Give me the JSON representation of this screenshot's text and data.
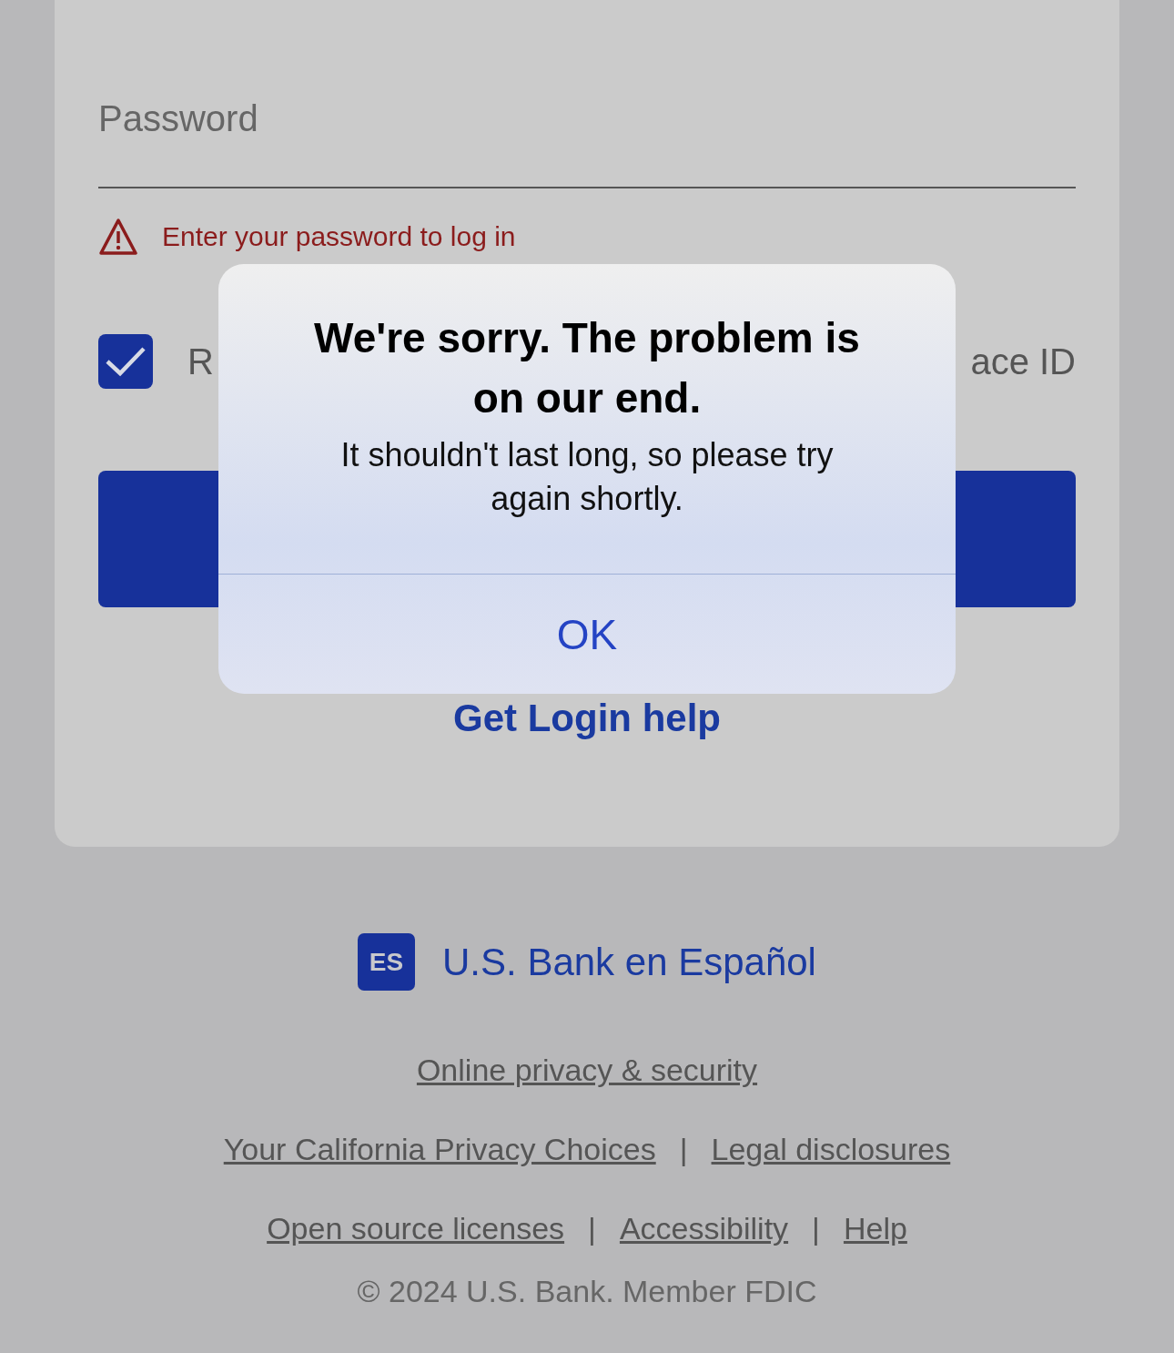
{
  "password_field": {
    "placeholder": "Password"
  },
  "error": {
    "message": "Enter your password to log in"
  },
  "remember": {
    "checked": true,
    "label_start": "R",
    "label_end": "ace ID"
  },
  "login_help": "Get Login help",
  "language_link": {
    "badge": "ES",
    "label": "U.S. Bank en Español"
  },
  "footer_links": [
    [
      {
        "kind": "link",
        "text": "Online privacy & security"
      }
    ],
    [
      {
        "kind": "link",
        "text": "Your California Privacy Choices"
      },
      {
        "kind": "separator",
        "text": "|"
      },
      {
        "kind": "link",
        "text": "Legal disclosures"
      }
    ],
    [
      {
        "kind": "link",
        "text": "Open source licenses"
      },
      {
        "kind": "separator",
        "text": "|"
      },
      {
        "kind": "link",
        "text": "Accessibility"
      },
      {
        "kind": "separator",
        "text": "|"
      },
      {
        "kind": "link",
        "text": "Help"
      }
    ]
  ],
  "copyright": "© 2024 U.S. Bank. Member FDIC",
  "dialog": {
    "title": "We're sorry. The problem is on our end.",
    "message": "It shouldn't last long, so please try again shortly.",
    "buttons": [
      "OK"
    ]
  }
}
